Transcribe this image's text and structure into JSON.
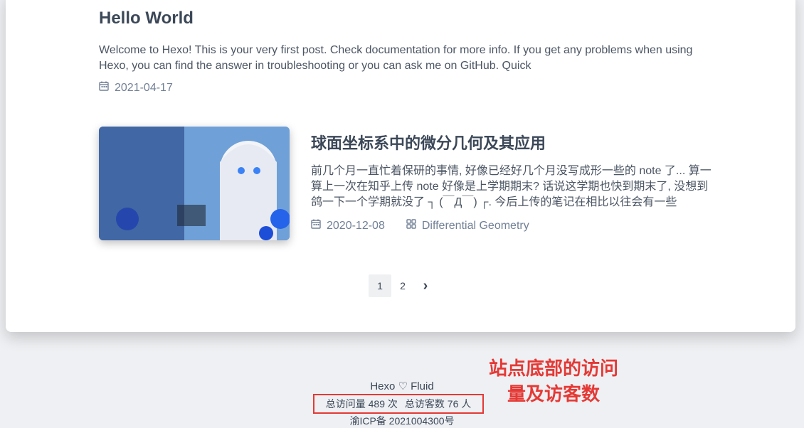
{
  "post1": {
    "title": "Hello World",
    "excerpt": "Welcome to Hexo! This is your very first post. Check documentation for more info. If you get any problems when using Hexo, you can find the answer in troubleshooting or you can ask me on GitHub. Quick",
    "date": "2021-04-17"
  },
  "post2": {
    "title": "球面坐标系中的微分几何及其应用",
    "excerpt": "前几个月一直忙着保研的事情, 好像已经好几个月没写成形一些的 note 了... 算一算上一次在知乎上传 note 好像是上学期期末? 话说这学期也快到期末了, 没想到鸽一下一个学期就没了 ┐ (￣Д￣) ┌. 今后上传的笔记在相比以往会有一些",
    "date": "2020-12-08",
    "category": "Differential Geometry"
  },
  "pagination": {
    "pages": [
      "1",
      "2"
    ],
    "current": "1",
    "next": "›"
  },
  "footer": {
    "powered": "Hexo ♡ Fluid",
    "total_visits": "总访问量 489 次",
    "total_visitors": "总访客数 76 人",
    "icp": "渝ICP备 2021004300号"
  },
  "annotation": {
    "text_line1": "站点底部的访问",
    "text_line2": "量及访客数"
  },
  "colors": {
    "annotation": "#e53935",
    "text": "#3c4858",
    "meta": "#718096"
  }
}
